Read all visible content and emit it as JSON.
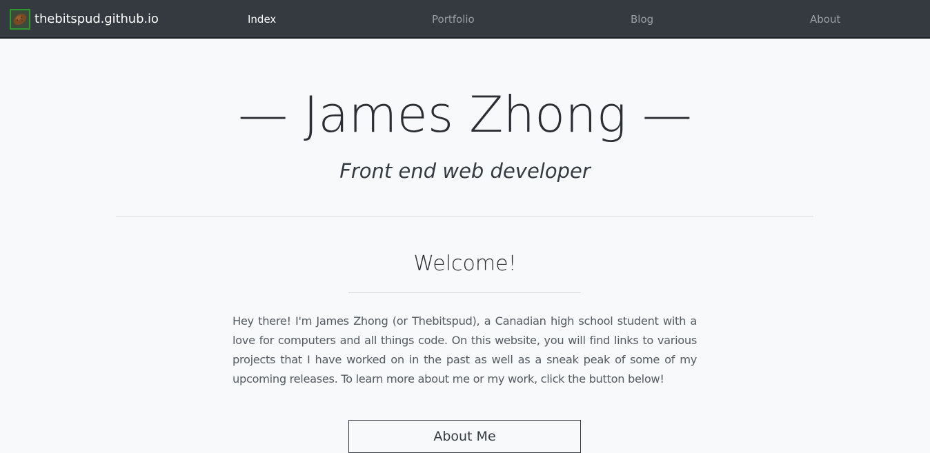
{
  "navbar": {
    "brand": "thebitspud.github.io",
    "brand_icon": "potato-logo-icon",
    "items": [
      {
        "label": "Index",
        "active": true
      },
      {
        "label": "Portfolio",
        "active": false
      },
      {
        "label": "Blog",
        "active": false
      },
      {
        "label": "About",
        "active": false
      }
    ]
  },
  "hero": {
    "title": "— James Zhong —",
    "subtitle": "Front end web developer"
  },
  "welcome": {
    "title": "Welcome!",
    "text": "Hey there! I'm James Zhong (or Thebitspud), a Canadian high school student with a love for computers and all things code. On this website, you will find links to various projects that I have worked on in the past as well as a sneak peak of some of my upcoming releases. To learn more about me or my work, click the button below!",
    "button_label": "About Me"
  },
  "colors": {
    "navbar_bg": "#343a40",
    "page_bg": "#f8f9fa",
    "nav_active": "#ffffff",
    "nav_inactive": "#9aa0a6"
  }
}
